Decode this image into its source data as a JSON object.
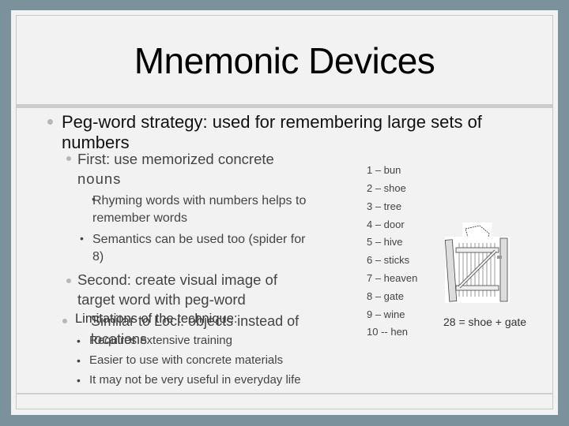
{
  "slide": {
    "title": "Mnemonic Devices",
    "bullets": {
      "main": [
        "Peg-word strategy: used for remembering large sets of",
        "numbers"
      ],
      "first": [
        "First: use memorized concrete",
        "nouns"
      ],
      "rhyming": [
        "Rhyming words with numbers helps to",
        "remember words"
      ],
      "semantics": [
        "Semantics can be used too (spider for",
        "8)"
      ],
      "second": [
        "Second: create visual image of",
        "target word with peg-word"
      ],
      "similar": [
        "Similar to Loci: objects instead of",
        "locations"
      ],
      "limitations": "Limitations of the technique:",
      "limit_items": [
        "Requires extensive training",
        "Easier to use with concrete materials",
        "It may not be very useful in everyday life"
      ]
    },
    "peg_list": [
      "1 – bun",
      "2 – shoe",
      "3 – tree",
      "4 – door",
      "5 – hive",
      "6 – sticks",
      "7 – heaven",
      "8 – gate",
      "9 – wine",
      "10 -- hen"
    ],
    "image_caption": "28 = shoe + gate",
    "image_alt": "shoe-and-gate-illustration"
  }
}
